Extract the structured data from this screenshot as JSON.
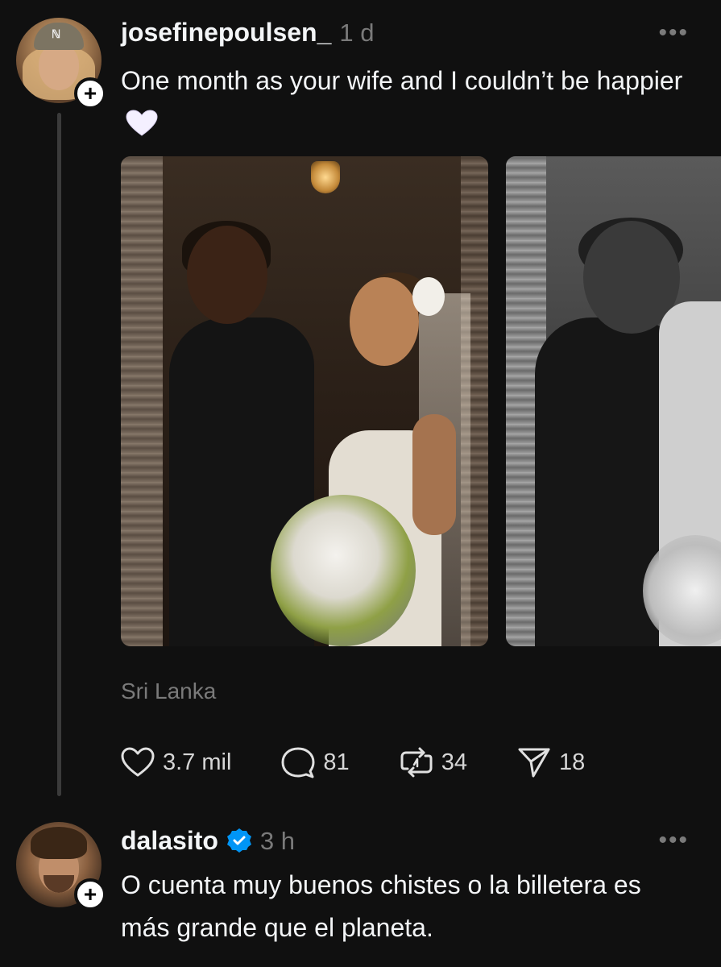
{
  "posts": [
    {
      "username": "josefinepoulsen_",
      "time": "1 d",
      "text": "One month as your wife and I couldn’t be happier",
      "emoji": "white-heart-emoji",
      "location": "Sri Lanka",
      "images": [
        "wedding-photo-couple-facing",
        "wedding-photo-couple-kissing"
      ],
      "actions": {
        "likes": "3.7 mil",
        "replies": "81",
        "reposts": "34",
        "shares": "18"
      }
    },
    {
      "username": "dalasito",
      "verified": true,
      "time": "3 h",
      "text": "O cuenta muy buenos chistes o la billetera es más grande que el planeta."
    }
  ],
  "colors": {
    "background": "#101010",
    "text_primary": "#f3f5f7",
    "text_secondary": "#7a7a7a",
    "verified_blue": "#0095f6",
    "thread_line": "#3b3b3b"
  },
  "icons": {
    "follow": "plus-icon",
    "more": "more-dots-icon",
    "like": "heart-icon",
    "reply": "comment-icon",
    "repost": "repost-icon",
    "share": "send-icon",
    "verified": "verified-badge-icon"
  }
}
